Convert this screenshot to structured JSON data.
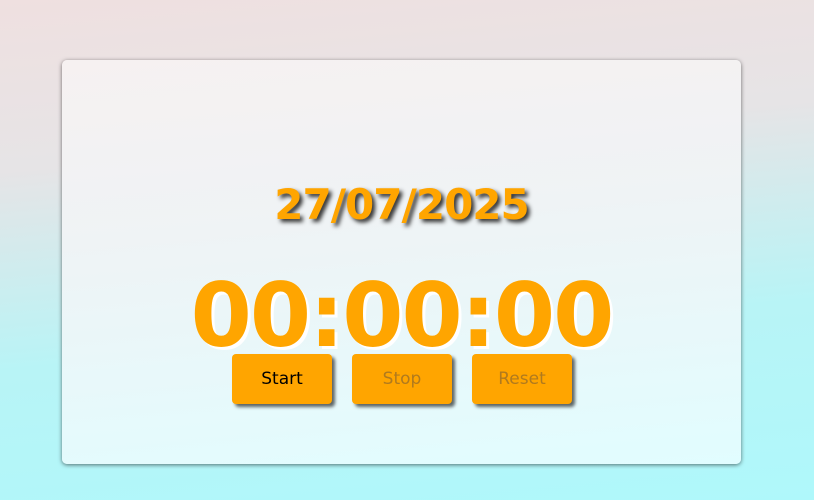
{
  "date": "27/07/2025",
  "timer": "00:00:00",
  "buttons": {
    "start": "Start",
    "stop": "Stop",
    "reset": "Reset"
  },
  "colors": {
    "accent": "#ffa500"
  }
}
